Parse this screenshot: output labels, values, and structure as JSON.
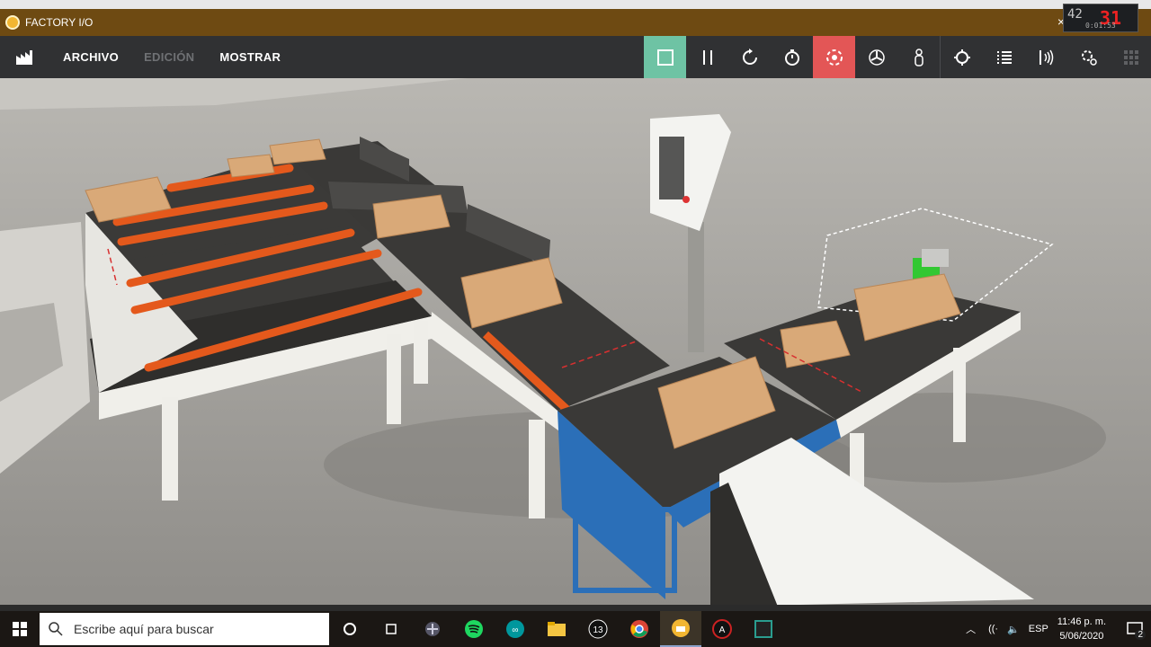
{
  "window": {
    "title": "FACTORY I/O",
    "close_label": "×"
  },
  "menu": {
    "file": "ARCHIVO",
    "edit": "EDICIÓN",
    "show": "MOSTRAR"
  },
  "toolbar": {
    "icons": [
      "stop-icon",
      "pause-icon",
      "reset-icon",
      "timer-icon",
      "camera-orbit-icon",
      "fan-icon",
      "first-person-icon",
      "target-icon",
      "list-icon",
      "sensor-icon",
      "settings-icon",
      "grid-icon"
    ]
  },
  "overlay_clock": {
    "left": "42",
    "right": "31",
    "elapsed": "0:01:53"
  },
  "scene": {
    "label": "3D factory scene: sorting conveyors with cardboard boxes",
    "box_icons": [
      "box-1",
      "box-2",
      "box-3",
      "box-4",
      "box-5",
      "box-6",
      "box-7"
    ]
  },
  "taskbar": {
    "search_placeholder": "Escribe aquí para buscar",
    "language": "ESP",
    "time": "11:46 p. m.",
    "date": "5/06/2020",
    "notification_count": "2"
  },
  "colors": {
    "title": "#6e4a12",
    "menubar": "#303133",
    "stop": "#6ec3a4",
    "active_red": "#e35656",
    "conveyor_orange": "#e4591c",
    "box": "#d9a978"
  }
}
